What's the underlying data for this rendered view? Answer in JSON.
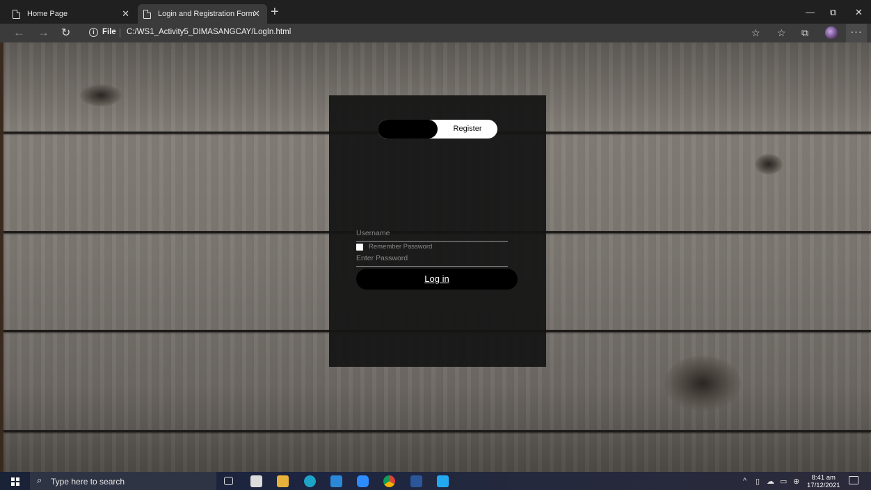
{
  "browser": {
    "tabs": [
      {
        "title": "Home Page",
        "active": false
      },
      {
        "title": "Login and Registration Form",
        "active": true
      }
    ],
    "address": {
      "scheme_label": "File",
      "url": "C:/WS1_Activity5_DIMASANGCAY/LogIn.html"
    }
  },
  "form": {
    "toggle": {
      "register_label": "Register"
    },
    "username_placeholder": "Username",
    "password_placeholder": "Enter Password",
    "remember_label": "Remember Password",
    "submit_label": "Log in"
  },
  "taskbar": {
    "search_placeholder": "Type here to search",
    "time": "8:41 am",
    "date": "17/12/2021"
  },
  "colors": {
    "card_bg": "#141414",
    "button_bg": "#000000",
    "toggle_bg": "#ffffff"
  }
}
